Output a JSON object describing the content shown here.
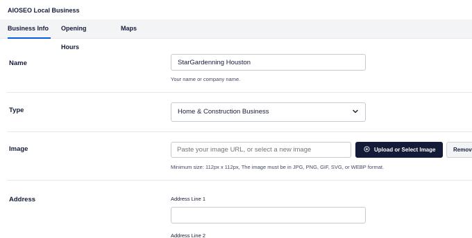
{
  "header": {
    "title": "AIOSEO Local Business"
  },
  "tabs": [
    {
      "label": "Business Info",
      "active": true
    },
    {
      "label": "Opening Hours",
      "active": false
    },
    {
      "label": "Maps",
      "active": false
    }
  ],
  "name": {
    "label": "Name",
    "value": "StarGardenning Houston",
    "help": "Your name or company name."
  },
  "type": {
    "label": "Type",
    "selected": "Home & Construction Business",
    "icon": "chevron-down-icon"
  },
  "image": {
    "label": "Image",
    "placeholder": "Paste your image URL, or select a new image",
    "upload_label": "Upload or Select Image",
    "upload_icon": "upload-icon",
    "remove_label": "Remove",
    "help": "Minimum size: 112px x 112px, The image must be in JPG, PNG, GIF, SVG, or WEBP format."
  },
  "address": {
    "label": "Address",
    "line1_label": "Address Line 1",
    "line1_value": "",
    "line2_label": "Address Line 2"
  },
  "colors": {
    "accent": "#005ae0",
    "dark_button": "#141b38",
    "border": "#c7c9d1",
    "tab_bg": "#f3f4f5"
  }
}
